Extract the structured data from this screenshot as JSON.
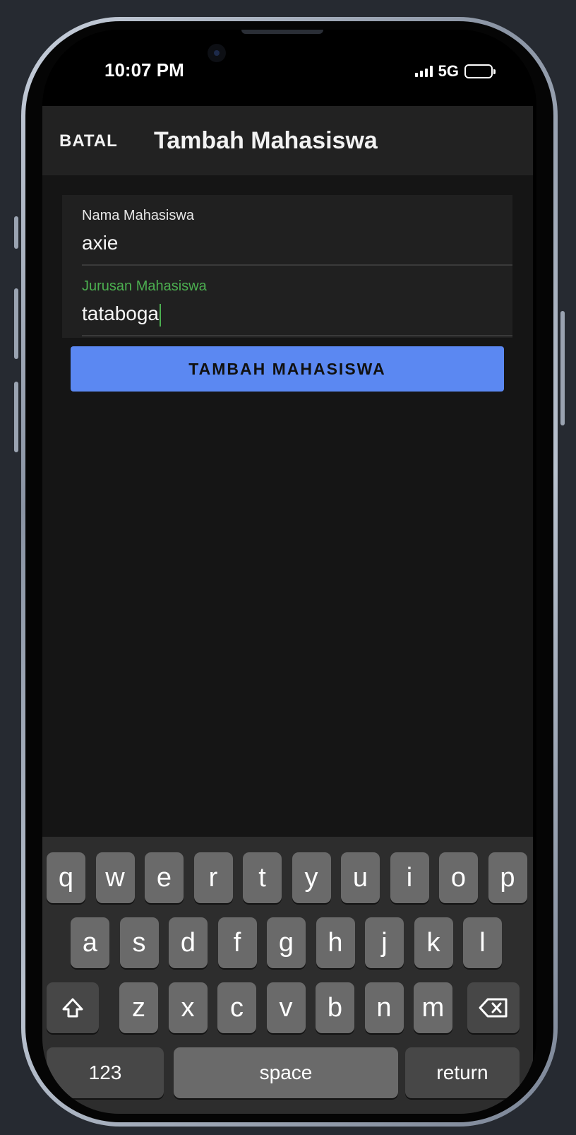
{
  "status_bar": {
    "time": "10:07 PM",
    "network": "5G"
  },
  "app_bar": {
    "cancel_label": "BATAL",
    "title": "Tambah Mahasiswa"
  },
  "form": {
    "name_label": "Nama Mahasiswa",
    "name_value": "axie",
    "major_label": "Jurusan Mahasiswa",
    "major_value": "tataboga"
  },
  "submit_label": "TAMBAH MAHASISWA",
  "keyboard": {
    "row1": [
      "q",
      "w",
      "e",
      "r",
      "t",
      "y",
      "u",
      "i",
      "o",
      "p"
    ],
    "row2": [
      "a",
      "s",
      "d",
      "f",
      "g",
      "h",
      "j",
      "k",
      "l"
    ],
    "row3": [
      "z",
      "x",
      "c",
      "v",
      "b",
      "n",
      "m"
    ],
    "numbers_label": "123",
    "space_label": "space",
    "return_label": "return"
  },
  "colors": {
    "accent_button": "#5b88f2",
    "focused_label": "#4caf50",
    "app_background": "#151515"
  }
}
